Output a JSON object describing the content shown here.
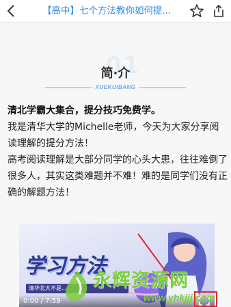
{
  "navbar": {
    "title": "【高中】七个方法教你如何提...",
    "back_icon": "chevron-left-icon",
    "favorite_icon": "star-outline-icon",
    "share_icon": "share-icon",
    "accent_color": "#2e8ae6"
  },
  "section": {
    "number": "01",
    "title": "简·介",
    "label": "XUEKUIBANG"
  },
  "article": {
    "headline": "清北学霸大集合，提分技巧免费学。",
    "paragraph1": "我是清华大学的Michelle老师，今天为大家分享阅读理解的提分方法！",
    "paragraph2": "高考阅读理解是大部分同学的心头大患，往往难倒了很多人，其实这类难题并不难！难的是同学们没有正确的解题方法！"
  },
  "video": {
    "cover_title": "学习方法",
    "subtitle": "清华北大不是...",
    "time": "0:00 / 7:59",
    "fullscreen_icon": "fullscreen-icon"
  },
  "watermark": {
    "text": "永辉资源网",
    "url": "www.yhkjjj.com"
  }
}
